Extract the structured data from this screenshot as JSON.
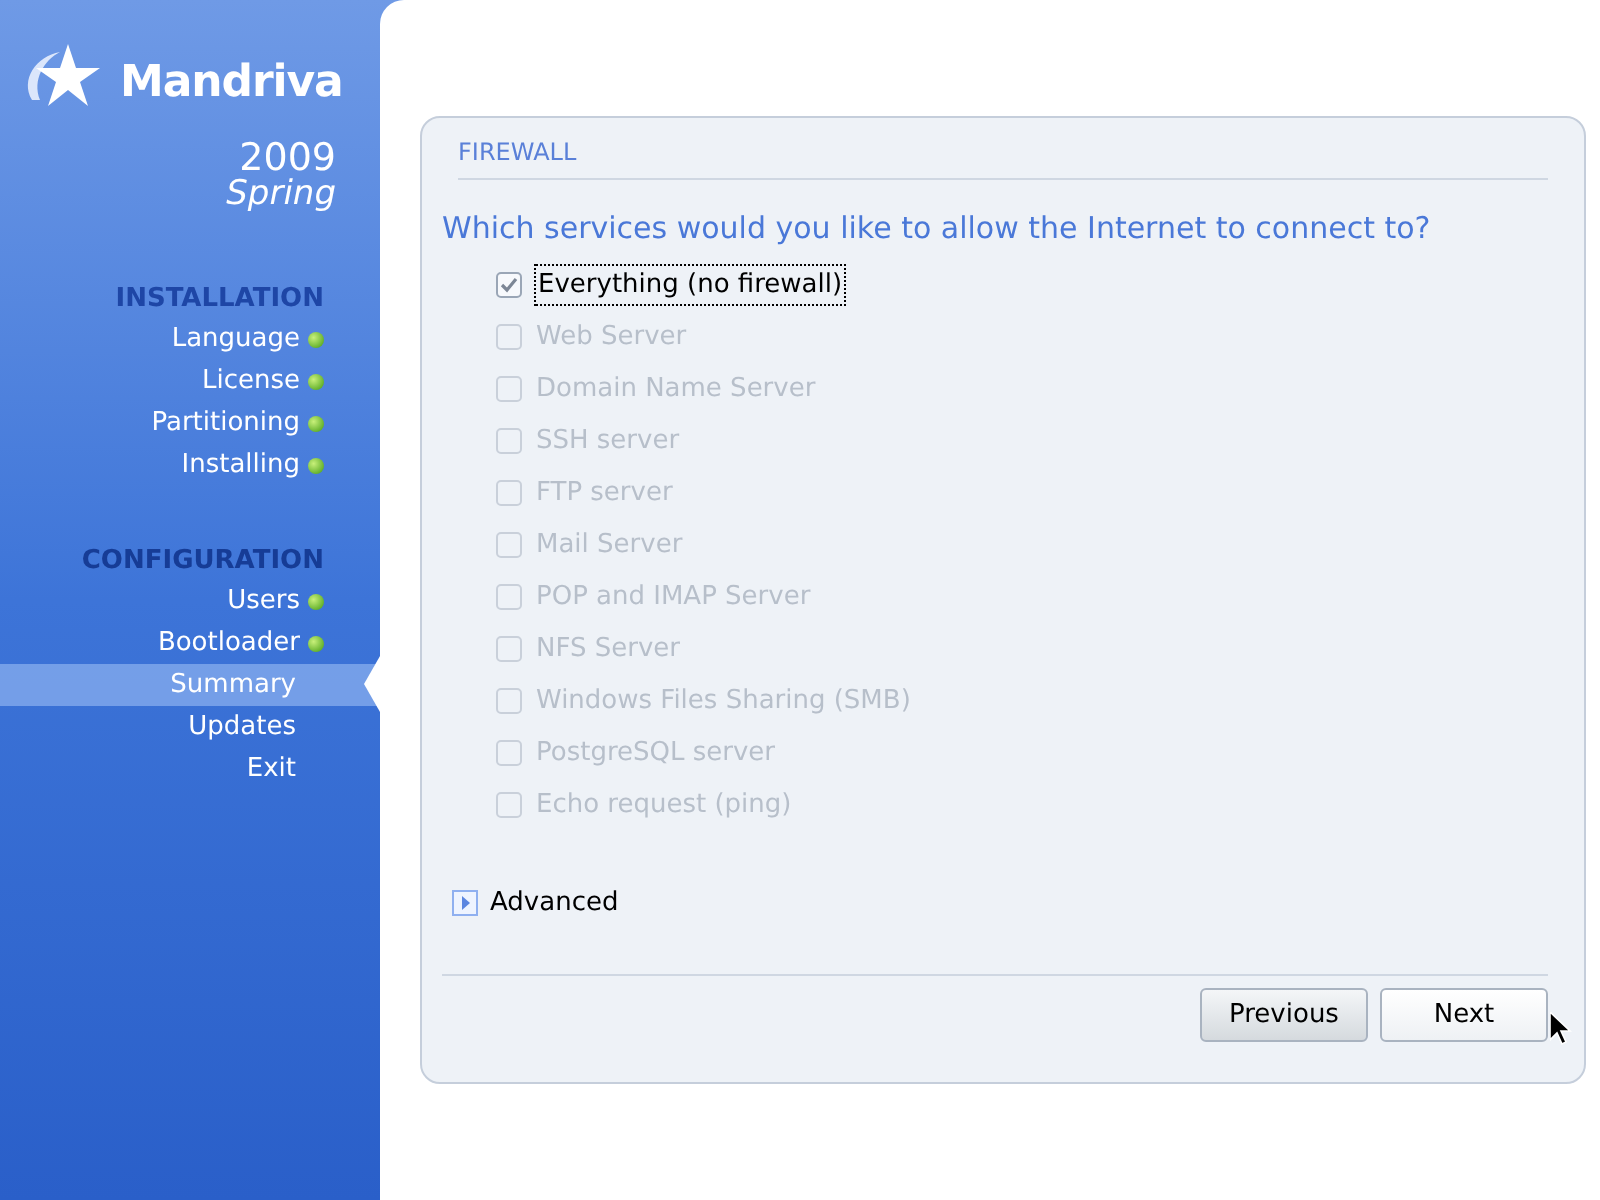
{
  "logo": {
    "brand": "Mandriva",
    "year": "2009",
    "edition": "Spring"
  },
  "sidebar": {
    "sections": [
      {
        "title": "INSTALLATION",
        "items": [
          {
            "label": "Language",
            "done": true,
            "selected": false
          },
          {
            "label": "License",
            "done": true,
            "selected": false
          },
          {
            "label": "Partitioning",
            "done": true,
            "selected": false
          },
          {
            "label": "Installing",
            "done": true,
            "selected": false
          }
        ]
      },
      {
        "title": "CONFIGURATION",
        "items": [
          {
            "label": "Users",
            "done": true,
            "selected": false
          },
          {
            "label": "Bootloader",
            "done": true,
            "selected": false
          },
          {
            "label": "Summary",
            "done": false,
            "selected": true
          },
          {
            "label": "Updates",
            "done": false,
            "selected": false
          },
          {
            "label": "Exit",
            "done": false,
            "selected": false
          }
        ]
      }
    ]
  },
  "panel": {
    "title": "FIREWALL",
    "question": "Which services would you like to allow the Internet to connect to?",
    "services": [
      {
        "label": "Everything (no firewall)",
        "checked": true,
        "disabled": false
      },
      {
        "label": "Web Server",
        "checked": false,
        "disabled": true
      },
      {
        "label": "Domain Name Server",
        "checked": false,
        "disabled": true
      },
      {
        "label": "SSH server",
        "checked": false,
        "disabled": true
      },
      {
        "label": "FTP server",
        "checked": false,
        "disabled": true
      },
      {
        "label": "Mail Server",
        "checked": false,
        "disabled": true
      },
      {
        "label": "POP and IMAP Server",
        "checked": false,
        "disabled": true
      },
      {
        "label": "NFS Server",
        "checked": false,
        "disabled": true
      },
      {
        "label": "Windows Files Sharing (SMB)",
        "checked": false,
        "disabled": true
      },
      {
        "label": "PostgreSQL server",
        "checked": false,
        "disabled": true
      },
      {
        "label": "Echo request (ping)",
        "checked": false,
        "disabled": true
      }
    ],
    "advanced": {
      "label": "Advanced",
      "expanded": false
    },
    "buttons": [
      "Previous",
      "Next"
    ]
  }
}
